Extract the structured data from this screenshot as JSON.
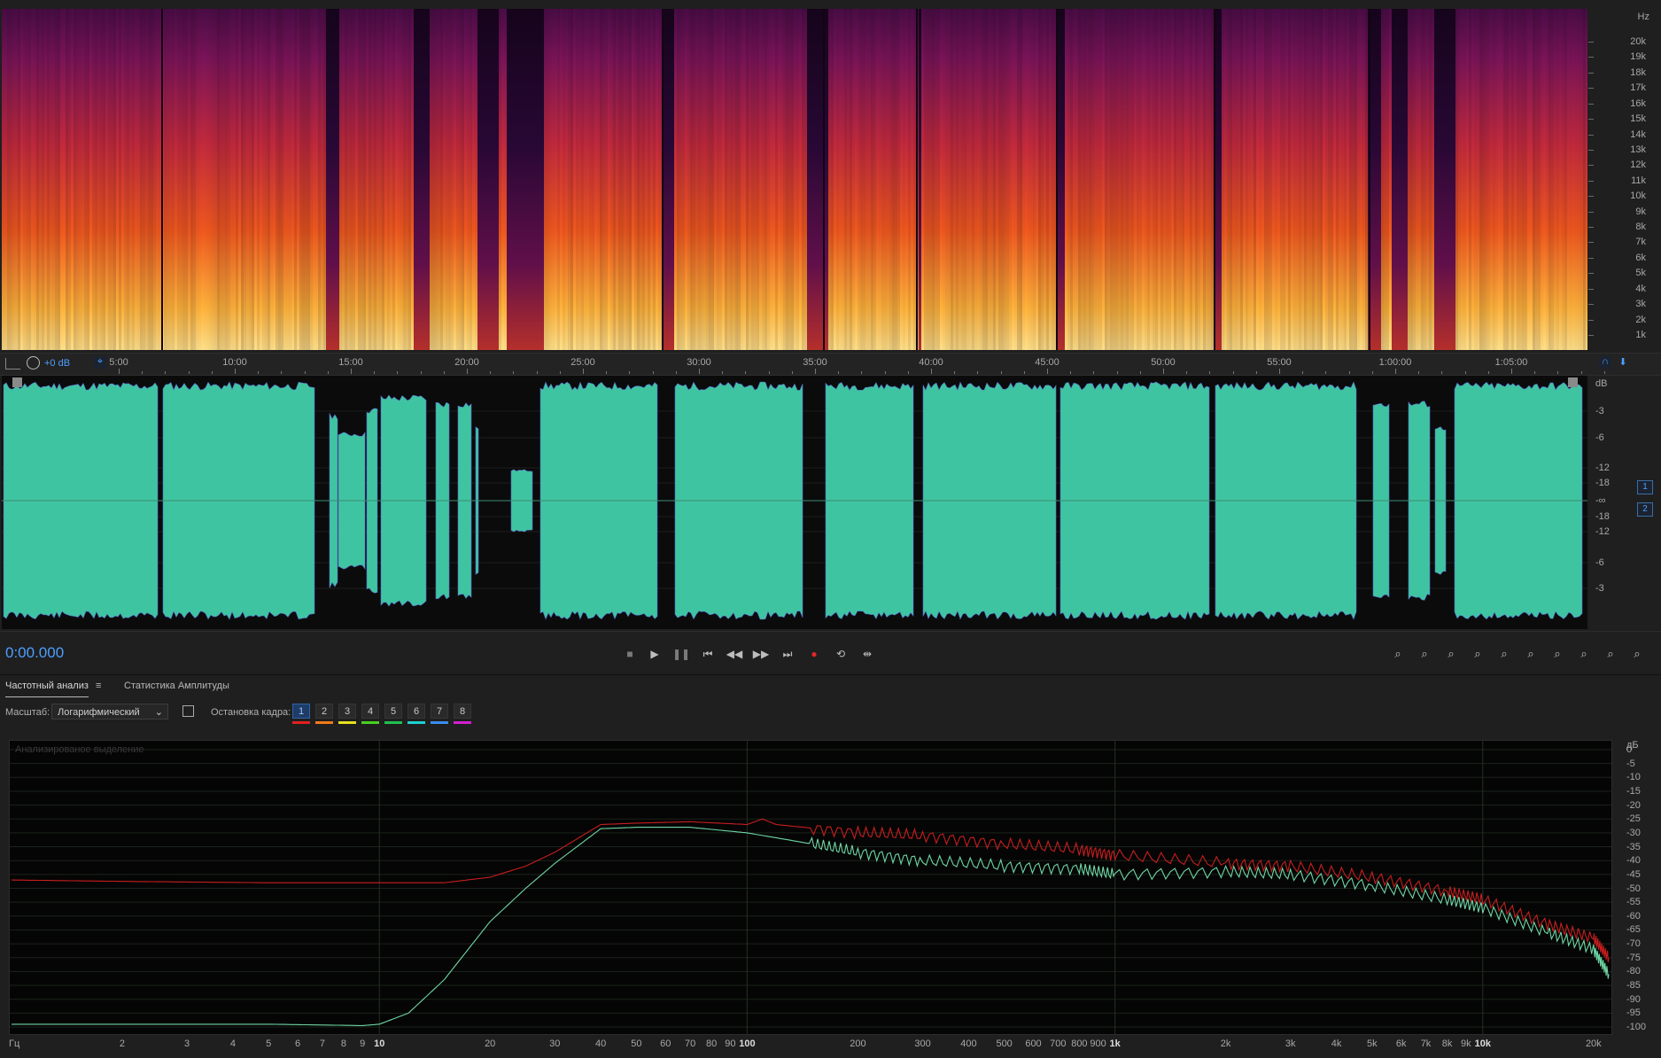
{
  "spectrogram": {
    "unit_label": "Hz",
    "freq_labels": [
      "20k",
      "19k",
      "18k",
      "17k",
      "16k",
      "15k",
      "14k",
      "13k",
      "12k",
      "11k",
      "10k",
      "9k",
      "8k",
      "7k",
      "6k",
      "5k",
      "4k",
      "3k",
      "2k",
      "1k"
    ]
  },
  "ruler": {
    "gain_label": "+0 dB",
    "time_labels": [
      "5:00",
      "10:00",
      "15:00",
      "20:00",
      "25:00",
      "30:00",
      "35:00",
      "40:00",
      "45:00",
      "50:00",
      "55:00",
      "1:00:00",
      "1:05:00"
    ]
  },
  "waveform": {
    "unit_label": "dB",
    "db_labels": [
      "-3",
      "-6",
      "-12",
      "-18",
      "-∞",
      "-18",
      "-12",
      "-6",
      "-3"
    ],
    "channels": [
      "1",
      "2"
    ],
    "fill_color": "#3fc4a1",
    "peak_color": "#5a6ed6"
  },
  "transport": {
    "timecode": "0:00.000",
    "buttons": [
      {
        "name": "stop-button",
        "glyph": "■"
      },
      {
        "name": "play-button",
        "glyph": "▶"
      },
      {
        "name": "pause-button",
        "glyph": "❚❚"
      },
      {
        "name": "go-to-start-button",
        "glyph": "⏮"
      },
      {
        "name": "rewind-button",
        "glyph": "◀◀"
      },
      {
        "name": "fast-forward-button",
        "glyph": "▶▶"
      },
      {
        "name": "go-to-end-button",
        "glyph": "⏭"
      },
      {
        "name": "record-button",
        "glyph": "●"
      },
      {
        "name": "loop-playback-button",
        "glyph": "⟲"
      },
      {
        "name": "skip-selection-button",
        "glyph": "⇹"
      }
    ],
    "zoom_buttons": [
      "zoom-in-amplitude-button",
      "zoom-out-amplitude-button",
      "zoom-reset-amplitude-button",
      "zoom-in-time-button",
      "zoom-out-time-button",
      "zoom-in-point-button",
      "zoom-out-full-button",
      "zoom-in-selection-button",
      "zoom-to-left-button",
      "zoom-to-right-button"
    ]
  },
  "analysis_panel": {
    "tabs": [
      "Частотный анализ",
      "Статистика Амплитуды"
    ],
    "scale_label": "Масштаб:",
    "scale_value": "Логарифмический",
    "freeze_label": "Остановка кадра:",
    "frames": [
      "1",
      "2",
      "3",
      "4",
      "5",
      "6",
      "7",
      "8"
    ],
    "frame_colors": [
      "#e02020",
      "#f07a1a",
      "#e6e020",
      "#48d020",
      "#20c050",
      "#20d0d0",
      "#3a8cf0",
      "#d020d0"
    ],
    "graph_caption": "Анализированое выделение",
    "db_unit": "дБ",
    "db_labels": [
      "0",
      "-5",
      "-10",
      "-15",
      "-20",
      "-25",
      "-30",
      "-35",
      "-40",
      "-45",
      "-50",
      "-55",
      "-60",
      "-65",
      "-70",
      "-75",
      "-80",
      "-85",
      "-90",
      "-95",
      "-100"
    ],
    "freq_unit": "Гц",
    "freq_labels": [
      "2",
      "3",
      "4",
      "5",
      "6",
      "7",
      "8",
      "9",
      "10",
      "20",
      "30",
      "40",
      "50",
      "60",
      "70",
      "80",
      "90",
      "100",
      "200",
      "300",
      "400",
      "500",
      "600",
      "700",
      "800",
      "900",
      "1k",
      "2k",
      "3k",
      "4k",
      "5k",
      "6k",
      "7k",
      "8k",
      "9k",
      "10k",
      "20k"
    ]
  },
  "chart_data": {
    "type": "line",
    "title": "Анализированое выделение",
    "xlabel": "Гц",
    "ylabel": "дБ",
    "xscale": "log",
    "xlim": [
      1,
      22000
    ],
    "ylim": [
      -100,
      0
    ],
    "series": [
      {
        "color": "#c81e1e",
        "points": [
          [
            1,
            -47
          ],
          [
            2,
            -47.5
          ],
          [
            5,
            -48
          ],
          [
            10,
            -48
          ],
          [
            15,
            -48
          ],
          [
            20,
            -46
          ],
          [
            25,
            -42
          ],
          [
            30,
            -37
          ],
          [
            40,
            -27
          ],
          [
            50,
            -26.5
          ],
          [
            70,
            -26
          ],
          [
            100,
            -27
          ],
          [
            110,
            -25
          ],
          [
            120,
            -27
          ],
          [
            200,
            -30
          ],
          [
            300,
            -31
          ],
          [
            500,
            -34
          ],
          [
            800,
            -36
          ],
          [
            1000,
            -38
          ],
          [
            2000,
            -41
          ],
          [
            3000,
            -42
          ],
          [
            5000,
            -46
          ],
          [
            8000,
            -51
          ],
          [
            10000,
            -54
          ],
          [
            15000,
            -63
          ],
          [
            20000,
            -68
          ],
          [
            22000,
            -75
          ]
        ]
      },
      {
        "color": "#6fd6a4",
        "points": [
          [
            1,
            -99
          ],
          [
            2,
            -99
          ],
          [
            5,
            -99
          ],
          [
            9,
            -99.5
          ],
          [
            10,
            -99
          ],
          [
            12,
            -95
          ],
          [
            15,
            -83
          ],
          [
            20,
            -62
          ],
          [
            25,
            -50
          ],
          [
            30,
            -41
          ],
          [
            40,
            -28.5
          ],
          [
            50,
            -28
          ],
          [
            70,
            -28
          ],
          [
            100,
            -30
          ],
          [
            150,
            -34
          ],
          [
            200,
            -37
          ],
          [
            300,
            -40
          ],
          [
            500,
            -42
          ],
          [
            800,
            -43
          ],
          [
            1000,
            -45
          ],
          [
            2000,
            -44
          ],
          [
            3000,
            -45
          ],
          [
            5000,
            -49
          ],
          [
            8000,
            -54
          ],
          [
            10000,
            -57
          ],
          [
            15000,
            -66
          ],
          [
            20000,
            -72
          ],
          [
            22000,
            -81
          ]
        ]
      }
    ]
  }
}
